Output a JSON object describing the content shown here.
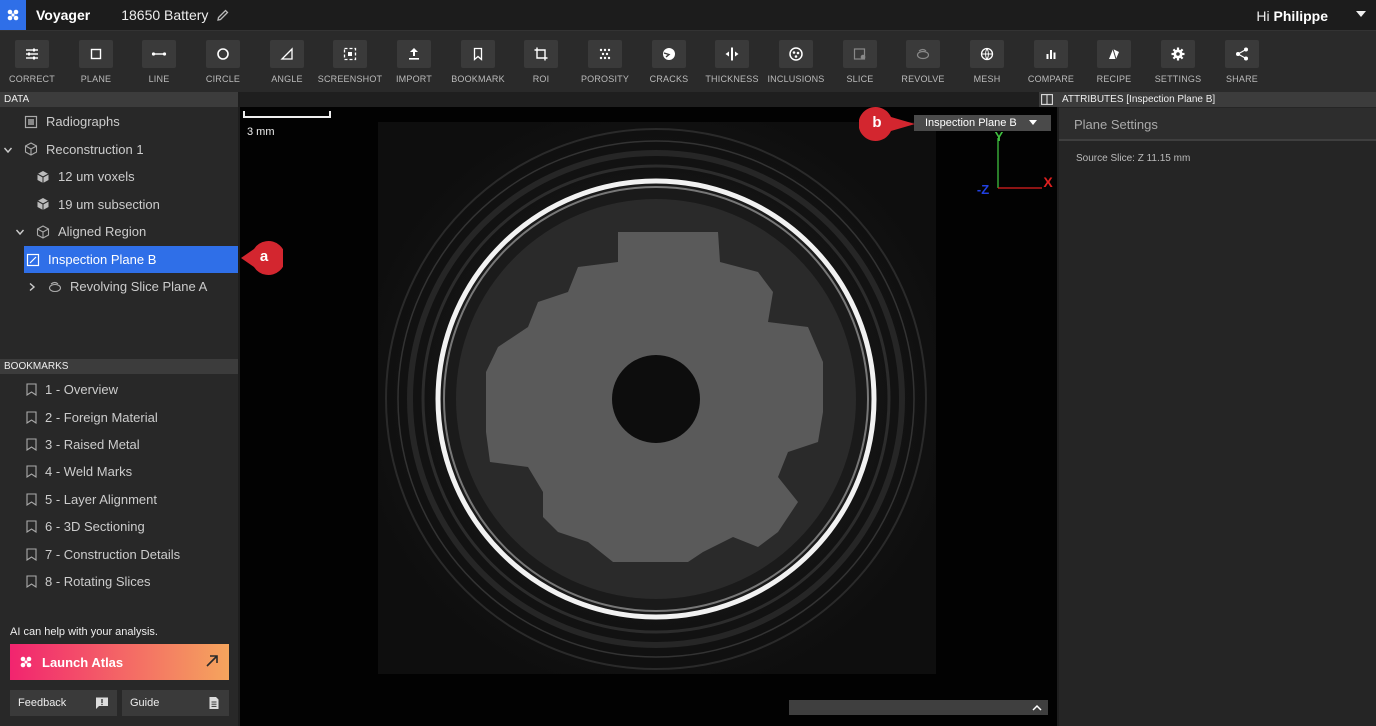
{
  "titlebar": {
    "app_name": "Voyager",
    "document_name": "18650 Battery",
    "greeting_prefix": "Hi",
    "user_name": "Philippe"
  },
  "toolbar": {
    "tools": [
      {
        "label": "CORRECT",
        "icon": "sliders-icon"
      },
      {
        "label": "PLANE",
        "icon": "square-icon"
      },
      {
        "label": "LINE",
        "icon": "line-icon"
      },
      {
        "label": "CIRCLE",
        "icon": "circle-icon"
      },
      {
        "label": "ANGLE",
        "icon": "angle-icon"
      },
      {
        "label": "SCREENSHOT",
        "icon": "screenshot-icon"
      },
      {
        "label": "IMPORT",
        "icon": "upload-icon"
      },
      {
        "label": "BOOKMARK",
        "icon": "bookmark-icon"
      },
      {
        "label": "ROI",
        "icon": "crop-icon"
      },
      {
        "label": "POROSITY",
        "icon": "dots-icon"
      },
      {
        "label": "CRACKS",
        "icon": "cracks-icon"
      },
      {
        "label": "THICKNESS",
        "icon": "thickness-icon"
      },
      {
        "label": "INCLUSIONS",
        "icon": "inclusions-icon"
      },
      {
        "label": "SLICE",
        "icon": "slice-icon"
      },
      {
        "label": "REVOLVE",
        "icon": "revolve-icon"
      },
      {
        "label": "MESH",
        "icon": "mesh-icon"
      },
      {
        "label": "COMPARE",
        "icon": "bar-chart-icon"
      },
      {
        "label": "RECIPE",
        "icon": "recipe-icon"
      },
      {
        "label": "SETTINGS",
        "icon": "gear-icon"
      },
      {
        "label": "SHARE",
        "icon": "share-icon"
      }
    ]
  },
  "data_panel": {
    "header": "DATA",
    "items": [
      {
        "label": "Radiographs"
      },
      {
        "label": "Reconstruction 1"
      },
      {
        "label": "12 um voxels"
      },
      {
        "label": "19 um subsection"
      },
      {
        "label": "Aligned Region"
      },
      {
        "label": "Inspection Plane B"
      },
      {
        "label": "Revolving Slice Plane A"
      }
    ]
  },
  "bookmarks": {
    "header": "BOOKMARKS",
    "items": [
      {
        "label": "1 - Overview"
      },
      {
        "label": "2 - Foreign Material"
      },
      {
        "label": "3 - Raised Metal"
      },
      {
        "label": "4 - Weld Marks"
      },
      {
        "label": "5 - Layer Alignment"
      },
      {
        "label": "6 - 3D Sectioning"
      },
      {
        "label": "7 - Construction Details"
      },
      {
        "label": "8 - Rotating Slices"
      }
    ]
  },
  "ai": {
    "prompt": "AI can help with your analysis.",
    "launch_label": "Launch Atlas",
    "feedback_label": "Feedback",
    "guide_label": "Guide"
  },
  "viewport": {
    "scale_label": "3 mm",
    "plane_selector": "Inspection Plane B",
    "axis_y": "Y",
    "axis_x": "X",
    "axis_z": "-Z",
    "marker_a": "a",
    "marker_b": "b",
    "colors": {
      "axis_y": "#3fbf3f",
      "axis_x": "#e02020",
      "axis_z": "#2040e0",
      "marker": "#d3262f"
    }
  },
  "attributes": {
    "header": "ATTRIBUTES [Inspection Plane B]",
    "section": "Plane Settings",
    "source_slice": "Source Slice: Z 11.15 mm"
  }
}
